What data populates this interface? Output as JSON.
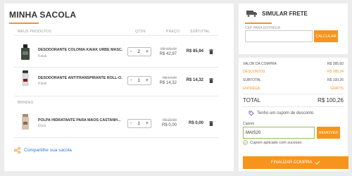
{
  "cart": {
    "title": "MINHA SACOLA",
    "columns": {
      "products": "MEUS PRODUTOS",
      "qty": "QTDE",
      "price": "PREÇO",
      "subtotal": "SUBTOTAL"
    },
    "items": [
      {
        "name": "DESODORANTE COLÔNIA KAIAK URBE MASC...",
        "brand": "Kaiak",
        "qty": "2",
        "price_old": "R$ 121,90",
        "price_new": "R$ 42,97",
        "subtotal": "R$ 85,94"
      },
      {
        "name": "DESODORANTE ANTITRANSPIRANTE ROLL-O...",
        "brand": "Kaiak",
        "qty": "1",
        "price_old": "R$ 17,90",
        "price_new": "R$ 14,32",
        "subtotal": "R$ 14,32"
      }
    ],
    "gifts_label": "BRINDES",
    "gifts": [
      {
        "name": "POLPA HIDRATANTE PARA MÃOS CASTANH...",
        "brand": "Ekos",
        "qty": "1",
        "price_old": "R$ 22,90",
        "price_new": "R$ 0,00",
        "subtotal": "R$ 0,00"
      }
    ],
    "share_label": "Compartilhe sua sacola"
  },
  "shipping": {
    "title": "SIMULAR FRETE",
    "cep_label": "CEP PARA ENTREGA",
    "cep_value": "",
    "button": "CALCULAR"
  },
  "summary": {
    "rows": [
      {
        "label": "VALOR DA COMPRA",
        "value": "R$ 285,60",
        "style": "gray"
      },
      {
        "label": "DESCONTOS",
        "value": "R$ 185,34",
        "style": "orange"
      },
      {
        "label": "SUBTOTAL",
        "value": "R$ 100,26",
        "style": "gray"
      },
      {
        "label": "ENTREGA",
        "value": "Grátis",
        "style": "orange"
      }
    ],
    "total_label": "TOTAL",
    "total_value": "R$ 100,26",
    "coupon_toggle": "Tenho um cupom de desconto",
    "coupon_label": "Cupom",
    "coupon_value": "MAIS20",
    "coupon_button": "REMOVER",
    "coupon_msg": "Cupom aplicado com sucesso.",
    "finalize": "FINALIZAR COMPRA"
  },
  "colors": {
    "accent": "#f7941d",
    "link": "#2a7bd1",
    "success": "#8fbf62"
  }
}
